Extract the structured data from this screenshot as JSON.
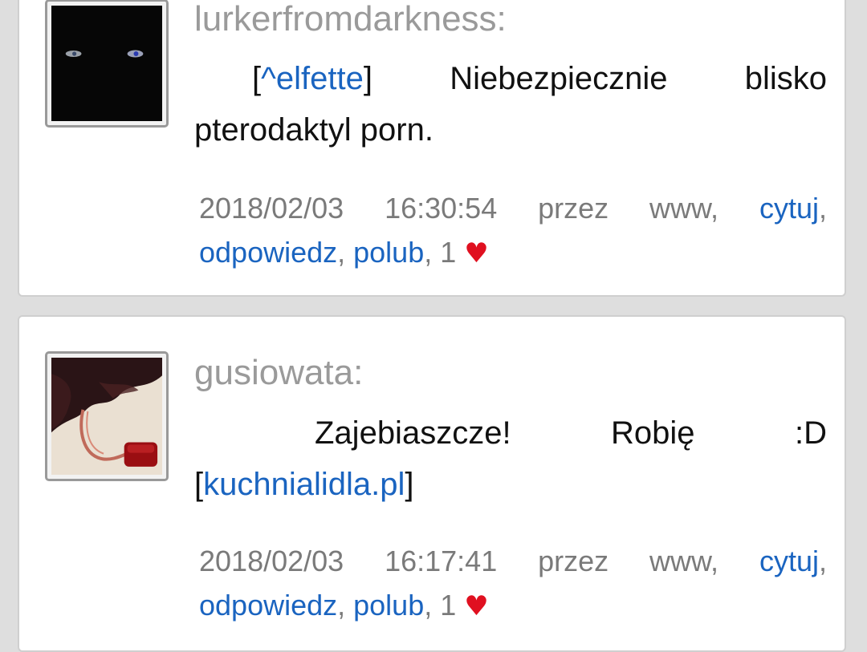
{
  "comments": [
    {
      "username": "lurkerfromdarkness:",
      "message": {
        "mention_open": "[",
        "mention": "^elfette",
        "mention_close": "]",
        "text": " Niebezpiecznie blisko pterodaktyl porn."
      },
      "meta": {
        "date": "2018/02/03",
        "time": "16:30:54",
        "via": "przez www,",
        "quote_label": "cytuj",
        "reply_label": "odpowiedz",
        "like_label": "polub",
        "likes": "1",
        "heart": "♥"
      },
      "avatar_icon": "dark-eyes-avatar"
    },
    {
      "username": "gusiowata:",
      "message": {
        "text": "Zajebiaszcze! Robię :D ",
        "link_open": "[",
        "link": "kuchnialidla.pl",
        "link_close": "]"
      },
      "meta": {
        "date": "2018/02/03",
        "time": "16:17:41",
        "via": "przez www,",
        "quote_label": "cytuj",
        "reply_label": "odpowiedz",
        "like_label": "polub",
        "likes": "1",
        "heart": "♥"
      },
      "avatar_icon": "hair-necklace-avatar"
    }
  ],
  "colors": {
    "link": "#1a64c0",
    "heart": "#e01020",
    "username": "#9a9a9a",
    "meta": "#7a7a7a",
    "background": "#dedede"
  }
}
